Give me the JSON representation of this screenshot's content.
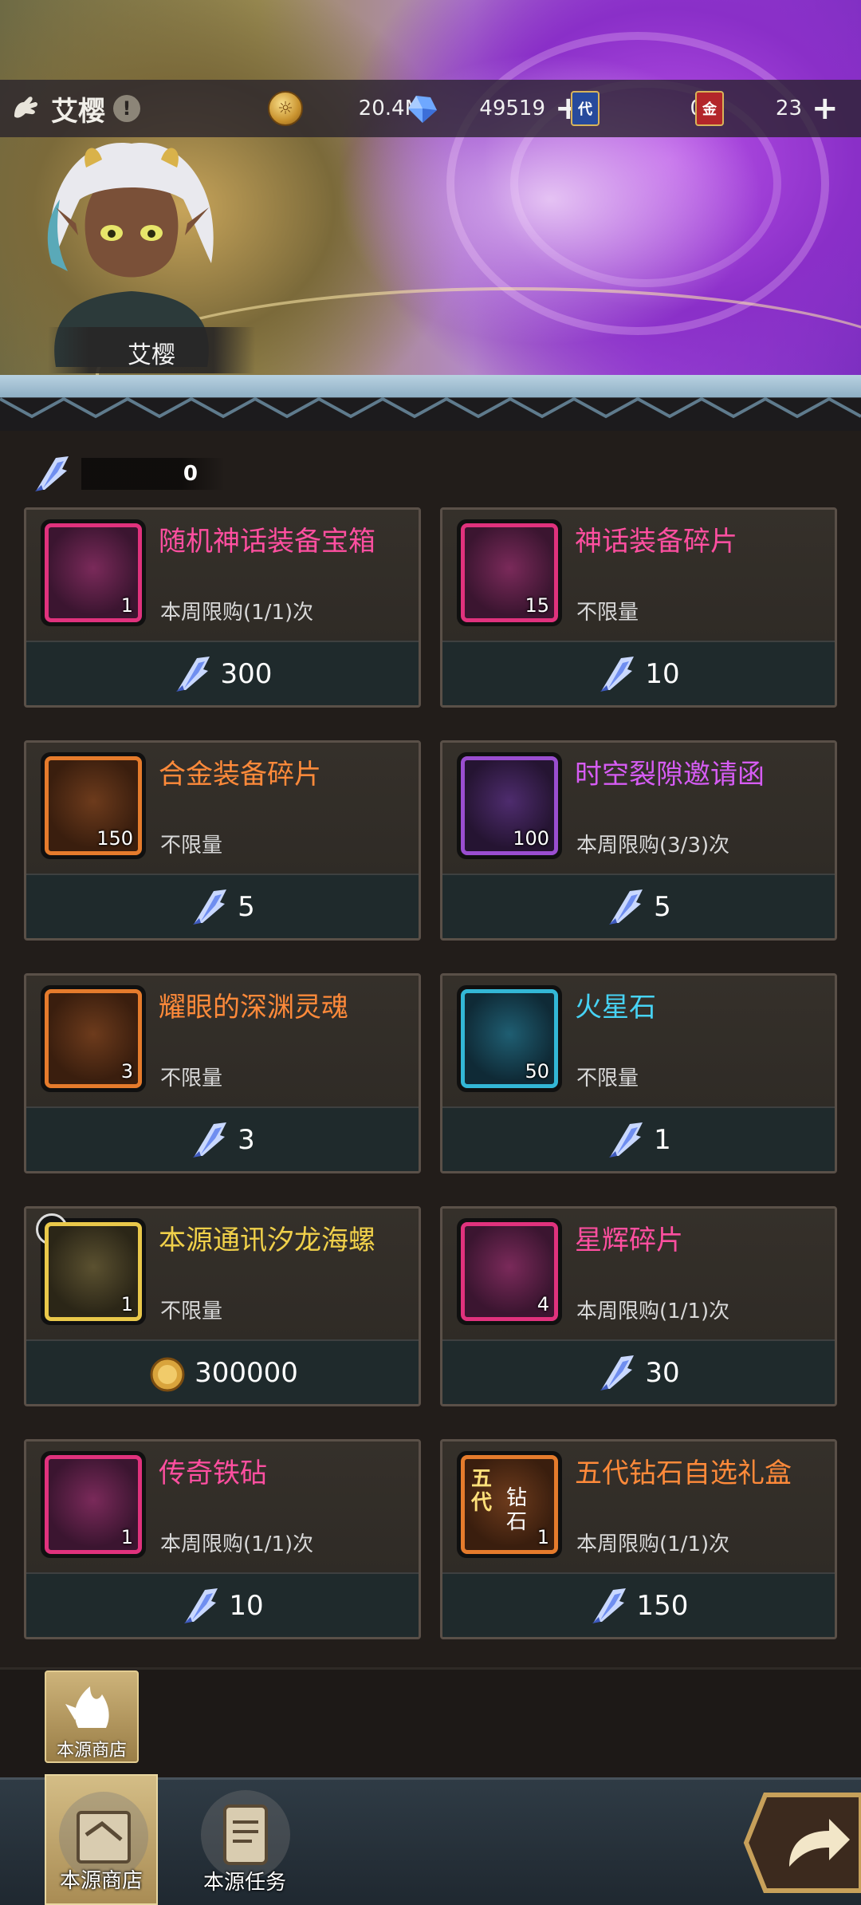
{
  "player": {
    "name": "艾樱"
  },
  "resources": {
    "gold": "20.4M",
    "gems": "49519",
    "ticket_a": {
      "badge": "代",
      "value": "0"
    },
    "ticket_b": {
      "badge": "金",
      "value": "23"
    }
  },
  "hero": {
    "name": "艾樱"
  },
  "currency": {
    "value": "0"
  },
  "items": [
    {
      "title": "随机神话装备宝箱",
      "qty": "1",
      "limit": "本周限购(1/1)次",
      "price": "300",
      "rarity": "pink",
      "price_icon": "crystal-shard-icon"
    },
    {
      "title": "神话装备碎片",
      "qty": "15",
      "limit": "不限量",
      "price": "10",
      "rarity": "pink",
      "price_icon": "crystal-shard-icon"
    },
    {
      "title": "合金装备碎片",
      "qty": "150",
      "limit": "不限量",
      "price": "5",
      "rarity": "orange",
      "price_icon": "crystal-shard-icon"
    },
    {
      "title": "时空裂隙邀请函",
      "qty": "100",
      "limit": "本周限购(3/3)次",
      "price": "5",
      "rarity": "purple",
      "price_icon": "crystal-shard-icon"
    },
    {
      "title": "耀眼的深渊灵魂",
      "qty": "3",
      "limit": "不限量",
      "price": "3",
      "rarity": "orange",
      "price_icon": "crystal-shard-icon"
    },
    {
      "title": "火星石",
      "qty": "50",
      "limit": "不限量",
      "price": "1",
      "rarity": "cyan",
      "price_icon": "crystal-shard-icon"
    },
    {
      "title": "本源通讯汐龙海螺",
      "qty": "1",
      "limit": "不限量",
      "price": "300000",
      "rarity": "gold",
      "price_icon": "gold-coin-icon"
    },
    {
      "title": "星辉碎片",
      "qty": "4",
      "limit": "本周限购(1/1)次",
      "price": "30",
      "rarity": "pink",
      "price_icon": "crystal-shard-icon"
    },
    {
      "title": "传奇铁砧",
      "qty": "1",
      "limit": "本周限购(1/1)次",
      "price": "10",
      "rarity": "pink",
      "price_icon": "crystal-shard-icon"
    },
    {
      "title": "五代钻石自选礼盒",
      "qty": "1",
      "limit": "本周限购(1/1)次",
      "price": "150",
      "rarity": "orange",
      "price_icon": "crystal-shard-icon",
      "icon_text": [
        "五",
        "代",
        "钻",
        "石"
      ]
    }
  ],
  "sub_tab": {
    "label": "本源商店"
  },
  "nav": {
    "shop_label": "本源商店",
    "task_label": "本源任务"
  },
  "colors": {
    "pink": "#ff4fa0",
    "orange": "#ff8a3a",
    "purple": "#d65cf4",
    "cyan": "#47d3f5",
    "gold": "#f0d04a"
  }
}
